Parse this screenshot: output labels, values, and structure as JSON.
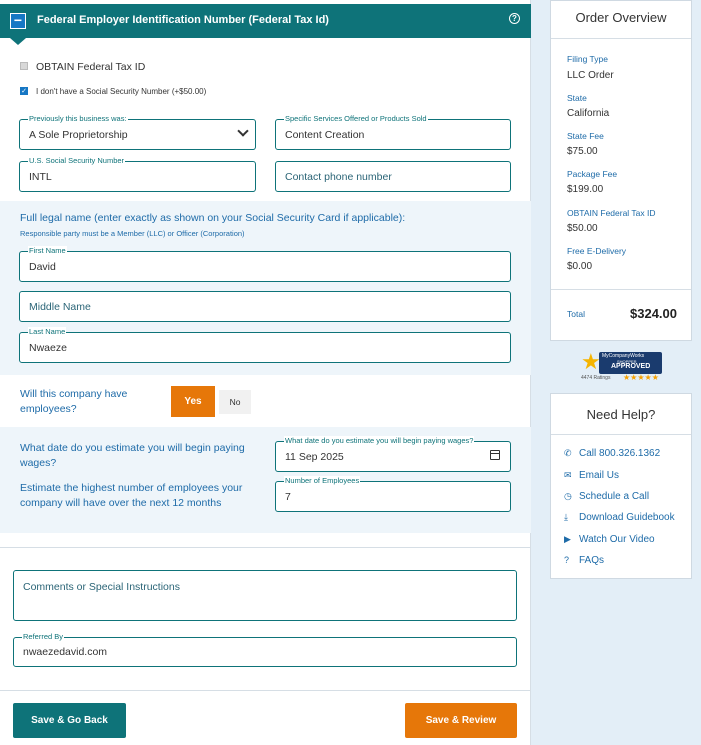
{
  "header": {
    "title": "Federal Employer Identification Number (Federal Tax Id)",
    "collapse_icon": "minus-icon",
    "help_icon": "help-circle-icon"
  },
  "options": {
    "obtain_label": "OBTAIN Federal Tax ID",
    "no_ssn_label": "I don't have a Social Security Number (+$50.00)"
  },
  "form": {
    "prev_business": {
      "label": "Previously this business was:",
      "value": "A Sole Proprietorship"
    },
    "services": {
      "label": "Specific Services Offered or Products Sold",
      "value": "Content Creation"
    },
    "ssn": {
      "label": "U.S. Social Security Number",
      "value": "INTL"
    },
    "phone": {
      "placeholder": "Contact phone number"
    },
    "legal_name_heading": "Full legal name (enter exactly as shown on your Social Security Card if applicable):",
    "legal_name_note": "Responsible party must be a Member (LLC) or Officer (Corporation)",
    "first_name": {
      "label": "First Name",
      "value": "David"
    },
    "middle_name": {
      "placeholder": "Middle Name"
    },
    "last_name": {
      "label": "Last Name",
      "value": "Nwaeze"
    },
    "employees_question": "Will this company have employees?",
    "yes_label": "Yes",
    "no_label": "No",
    "wages_question": "What date do you estimate you will begin paying wages?",
    "wages_date": {
      "label": "What date do you estimate you will begin paying wages?",
      "value": "11 Sep 2025"
    },
    "count_question": "Estimate the highest number of employees your company will have over the next 12 months",
    "employees_count": {
      "label": "Number of Employees",
      "value": "7"
    },
    "comments": {
      "placeholder": "Comments or Special Instructions"
    },
    "referred_by": {
      "label": "Referred By",
      "value": "nwaezedavid.com"
    }
  },
  "buttons": {
    "back": "Save & Go Back",
    "review": "Save & Review"
  },
  "order": {
    "title": "Order Overview",
    "items": [
      {
        "label": "Filing Type",
        "value": "LLC Order"
      },
      {
        "label": "State",
        "value": "California"
      },
      {
        "label": "State Fee",
        "value": "$75.00"
      },
      {
        "label": "Package Fee",
        "value": "$199.00"
      },
      {
        "label": "OBTAIN Federal Tax ID",
        "value": "$50.00"
      },
      {
        "label": "Free E-Delivery",
        "value": "$0.00"
      }
    ],
    "total_label": "Total",
    "total_value": "$324.00"
  },
  "badge": {
    "line1": "MyCompanyWorks",
    "line2": "SHOPPER",
    "line3": "APPROVED",
    "ratings": "4474 Ratings",
    "stars": "★★★★★"
  },
  "help": {
    "title": "Need Help?",
    "items": [
      {
        "label": "Call 800.326.1362",
        "icon": "phone-icon"
      },
      {
        "label": "Email Us",
        "icon": "envelope-icon"
      },
      {
        "label": "Schedule a Call",
        "icon": "clock-icon"
      },
      {
        "label": "Download Guidebook",
        "icon": "download-icon"
      },
      {
        "label": "Watch Our Video",
        "icon": "play-icon"
      },
      {
        "label": "FAQs",
        "icon": "question-icon"
      }
    ]
  },
  "colors": {
    "teal": "#0e7379",
    "orange": "#e67709",
    "link_blue": "#1e6ba8",
    "sidebar_bg": "#e3eef7"
  }
}
